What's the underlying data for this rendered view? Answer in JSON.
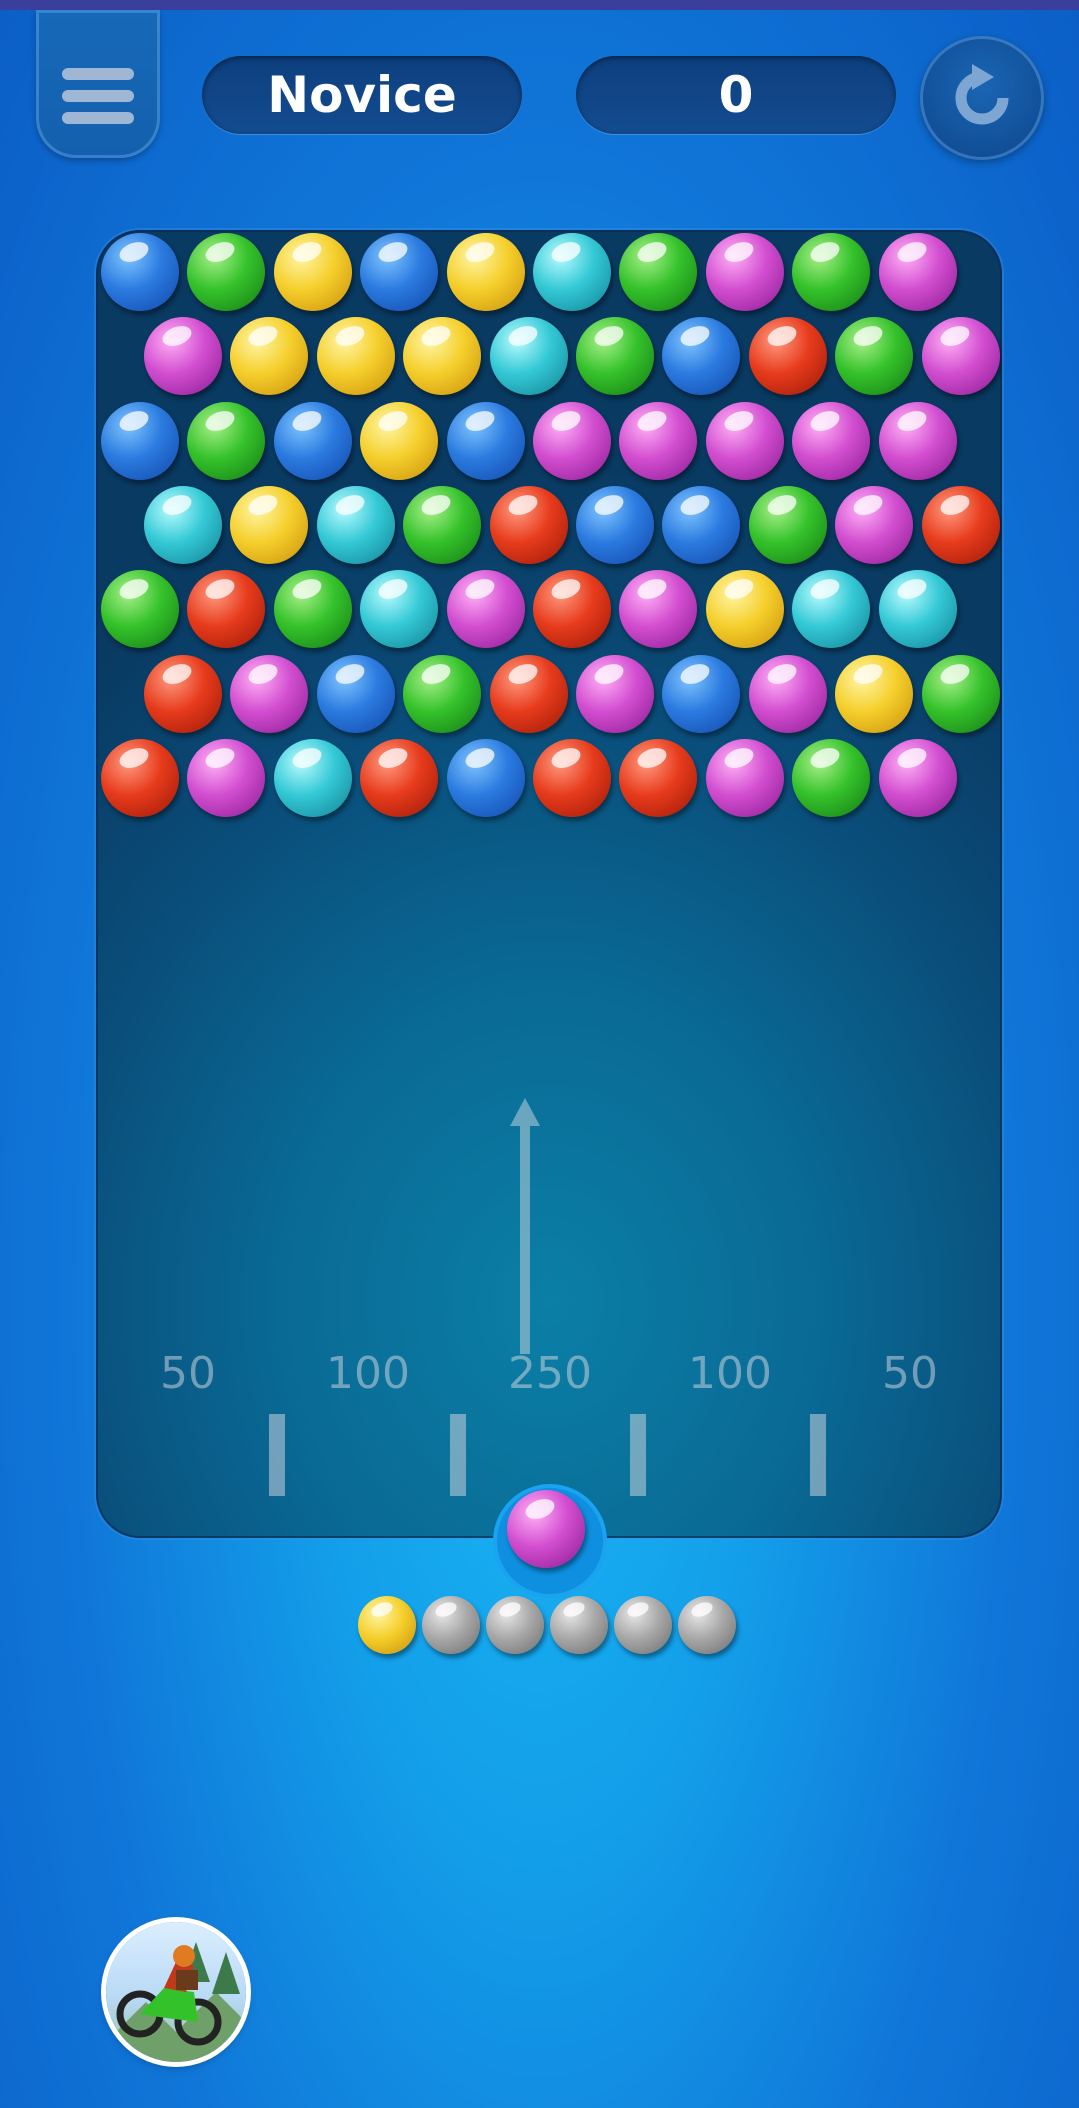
{
  "header": {
    "level_label": "Novice",
    "score": "0"
  },
  "board": {
    "rows": [
      [
        "blue",
        "green",
        "yellow",
        "blue",
        "yellow",
        "cyan",
        "green",
        "magenta",
        "green",
        "magenta"
      ],
      [
        "magenta",
        "yellow",
        "yellow",
        "yellow",
        "cyan",
        "green",
        "blue",
        "red",
        "green",
        "magenta"
      ],
      [
        "blue",
        "green",
        "blue",
        "yellow",
        "blue",
        "magenta",
        "magenta",
        "magenta",
        "magenta",
        "magenta"
      ],
      [
        "cyan",
        "yellow",
        "cyan",
        "green",
        "red",
        "blue",
        "blue",
        "green",
        "magenta",
        "red"
      ],
      [
        "green",
        "red",
        "green",
        "cyan",
        "magenta",
        "red",
        "magenta",
        "yellow",
        "cyan",
        "cyan"
      ],
      [
        "red",
        "magenta",
        "blue",
        "green",
        "red",
        "magenta",
        "blue",
        "magenta",
        "yellow",
        "green"
      ],
      [
        "red",
        "magenta",
        "cyan",
        "red",
        "blue",
        "red",
        "red",
        "magenta",
        "green",
        "magenta"
      ]
    ],
    "score_zones": [
      "50",
      "100",
      "250",
      "100",
      "50"
    ]
  },
  "shooter": {
    "current_bubble": "magenta",
    "queue": [
      "yellow",
      "grey",
      "grey",
      "grey",
      "grey",
      "grey"
    ]
  },
  "icons": {
    "menu": "hamburger-menu-icon",
    "restart": "restart-icon",
    "aim": "aim-arrow-icon",
    "promo": "motocross-game-promo-icon"
  },
  "colors": {
    "blue": "#2b7be0",
    "green": "#35c22b",
    "yellow": "#f5cf2c",
    "cyan": "#34c9d6",
    "magenta": "#d24ed0",
    "red": "#e73b1c",
    "grey": "#a9a9a9",
    "background": "#1076d8",
    "board": "#096a95"
  }
}
